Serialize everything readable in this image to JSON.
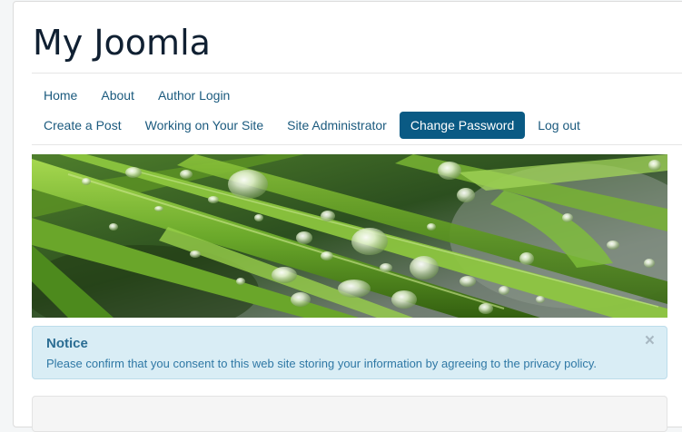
{
  "site": {
    "title": "My Joomla"
  },
  "menu": {
    "row1": [
      {
        "label": "Home"
      },
      {
        "label": "About"
      },
      {
        "label": "Author Login"
      }
    ],
    "row2": [
      {
        "label": "Create a Post"
      },
      {
        "label": "Working on Your Site"
      },
      {
        "label": "Site Administrator"
      },
      {
        "label": "Change Password",
        "active": true
      },
      {
        "label": "Log out"
      }
    ]
  },
  "banner": {
    "icon": "grass-with-water-droplets-image"
  },
  "notice": {
    "heading": "Notice",
    "message": "Please confirm that you consent to this web site storing your information by agreeing to the privacy policy.",
    "close_glyph": "×"
  },
  "colors": {
    "link": "#1b5a7e",
    "active_nav_bg": "#0a5a84",
    "notice_bg": "#d9edf5",
    "notice_text": "#2f78a5"
  }
}
